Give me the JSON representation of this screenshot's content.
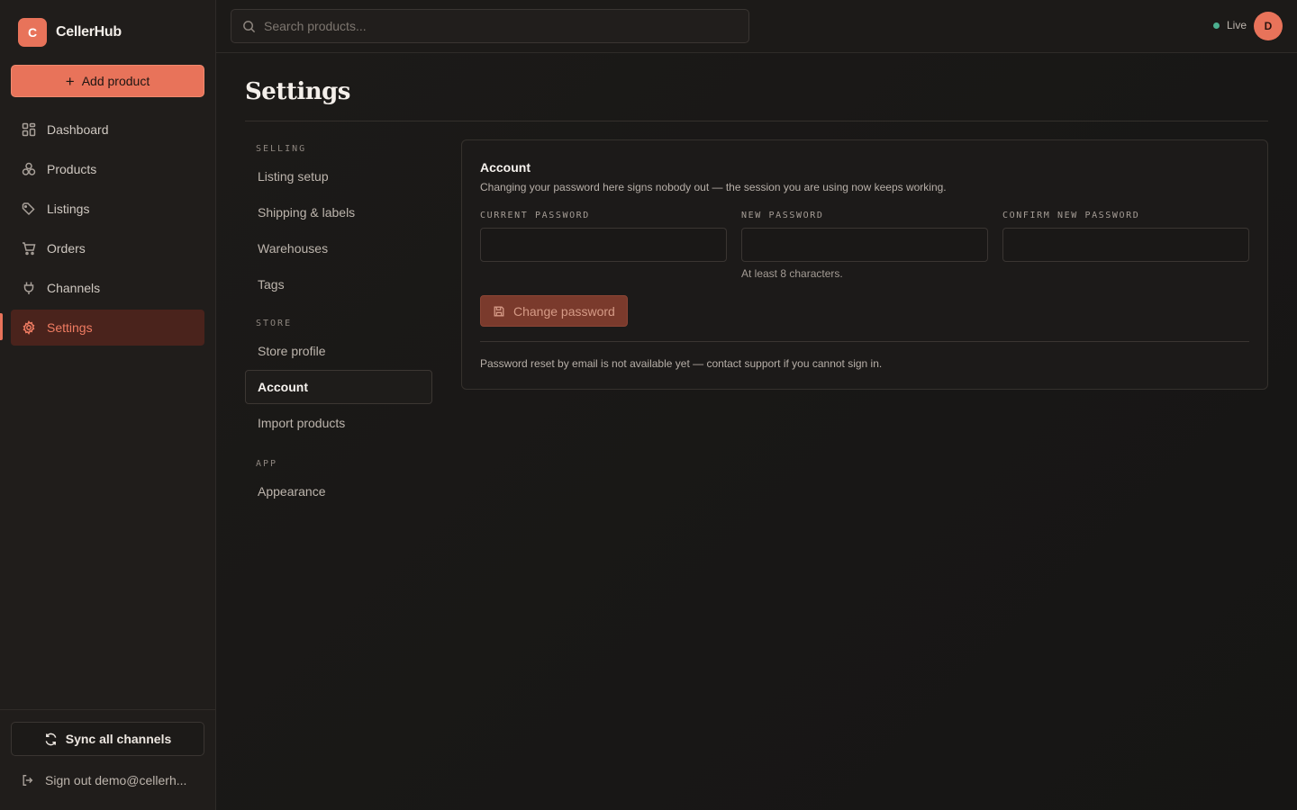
{
  "app": {
    "name": "CellerHub",
    "logo_letter": "C"
  },
  "sidebar": {
    "add_button": "Add product",
    "items": [
      {
        "label": "Dashboard",
        "icon": "dashboard-icon"
      },
      {
        "label": "Products",
        "icon": "products-icon"
      },
      {
        "label": "Listings",
        "icon": "tag-icon"
      },
      {
        "label": "Orders",
        "icon": "cart-icon"
      },
      {
        "label": "Channels",
        "icon": "plug-icon"
      },
      {
        "label": "Settings",
        "icon": "gear-icon",
        "active": true
      }
    ],
    "sync_button": "Sync all channels",
    "signout": "Sign out demo@cellerh..."
  },
  "topbar": {
    "search_placeholder": "Search products...",
    "status": "Live",
    "avatar_letter": "D"
  },
  "page": {
    "title": "Settings"
  },
  "subnav": {
    "selling_heading": "SELLING",
    "selling_items": [
      "Listing setup",
      "Shipping & labels",
      "Warehouses",
      "Tags"
    ],
    "store_heading": "STORE",
    "store_items": [
      "Store profile",
      "Account",
      "Import products"
    ],
    "app_heading": "APP",
    "app_items": [
      "Appearance"
    ],
    "active": "Account"
  },
  "account": {
    "title": "Account",
    "description": "Changing your password here signs nobody out — the session you are using now keeps working.",
    "current_password_label": "CURRENT PASSWORD",
    "new_password_label": "NEW PASSWORD",
    "new_password_hint": "At least 8 characters.",
    "confirm_password_label": "CONFIRM NEW PASSWORD",
    "current_password_value": "",
    "new_password_value": "",
    "confirm_password_value": "",
    "submit_label": "Change password",
    "note": "Password reset by email is not available yet — contact support if you cannot sign in."
  },
  "colors": {
    "accent": "#e8735a",
    "live_dot": "#4cb08f",
    "background": "#1a1817"
  }
}
